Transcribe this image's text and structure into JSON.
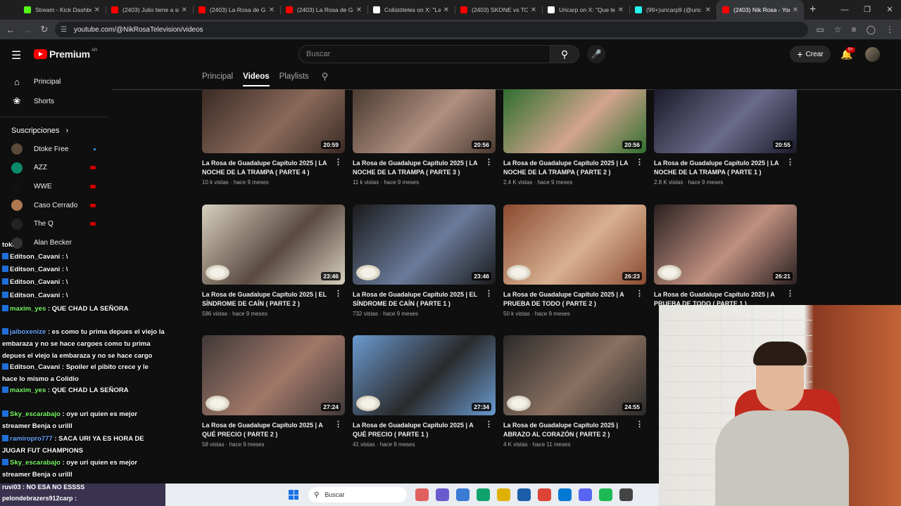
{
  "browser": {
    "tabs": [
      {
        "title": "Stream - Kick Dashbo",
        "favicon_color": "#53fc18",
        "active": false
      },
      {
        "title": "(2403) Julio tiene a su",
        "favicon_color": "#ff0000",
        "active": false
      },
      {
        "title": "(2403) La Rosa de Gu",
        "favicon_color": "#ff0000",
        "active": false
      },
      {
        "title": "(2403) La Rosa de Gu",
        "favicon_color": "#ff0000",
        "active": false
      },
      {
        "title": "Colistóteles on X: \"La",
        "favicon_color": "#ffffff",
        "active": false
      },
      {
        "title": "(2403) SKONE vs TOM",
        "favicon_color": "#ff0000",
        "active": false
      },
      {
        "title": "Uricarp on X: \"Que le",
        "favicon_color": "#ffffff",
        "active": false
      },
      {
        "title": "(99+)uricarp9 (@uric",
        "favicon_color": "#25f4ee",
        "active": false
      },
      {
        "title": "(2403) Nik Rosa - You",
        "favicon_color": "#ff0000",
        "active": true
      }
    ],
    "new_tab_icon": "+",
    "url": "youtube.com/@NikRosaTelevision/videos"
  },
  "youtube": {
    "logo_text": "Premium",
    "country_code": "AR",
    "search_placeholder": "Buscar",
    "create_label": "Crear",
    "notif_count": "9+"
  },
  "sidebar": {
    "items": [
      {
        "label": "Principal",
        "icon": "home-icon"
      },
      {
        "label": "Shorts",
        "icon": "shorts-icon"
      }
    ],
    "subs_header": "Suscripciones",
    "subscriptions": [
      {
        "name": "Dtoke Free",
        "avatar_color": "#5a4a3a",
        "indicator": "dot"
      },
      {
        "name": "AZZ",
        "avatar_color": "#0a8a6a",
        "indicator": "live"
      },
      {
        "name": "WWE",
        "avatar_color": "#111111",
        "indicator": "live"
      },
      {
        "name": "Caso Cerrado",
        "avatar_color": "#b07850",
        "indicator": "live"
      },
      {
        "name": "The Q",
        "avatar_color": "#222222",
        "indicator": "live"
      },
      {
        "name": "Alan Becker",
        "avatar_color": "#333333",
        "indicator": "none"
      }
    ]
  },
  "channel_tabs": [
    {
      "label": "Principal",
      "selected": false
    },
    {
      "label": "Videos",
      "selected": true
    },
    {
      "label": "Playlists",
      "selected": false
    }
  ],
  "videos": [
    {
      "title": "La Rosa de Guadalupe Capítulo 2025 | LA NOCHE DE LA TRAMPA ( PARTE 4 )",
      "views": "10 k vistas",
      "age": "hace 9 meses",
      "duration": "20:59"
    },
    {
      "title": "La Rosa de Guadalupe Capítulo 2025 | LA NOCHE DE LA TRAMPA ( PARTE 3 )",
      "views": "11 k vistas",
      "age": "hace 9 meses",
      "duration": "20:56"
    },
    {
      "title": "La Rosa de Guadalupe Capítulo 2025 | LA NOCHE DE LA TRAMPA ( PARTE 2 )",
      "views": "2.4 K vistas",
      "age": "hace 9 meses",
      "duration": "20:56"
    },
    {
      "title": "La Rosa de Guadalupe Capítulo 2025 | LA NOCHE DE LA TRAMPA ( PARTE 1 )",
      "views": "2.8 K vistas",
      "age": "hace 9 meses",
      "duration": "20:55"
    },
    {
      "title": "La Rosa de Guadalupe Capítulo 2025 | EL SÍNDROME DE CAÍN ( PARTE 2 )",
      "views": "586 vistas",
      "age": "hace 9 meses",
      "duration": "23:46"
    },
    {
      "title": "La Rosa de Guadalupe Capítulo 2025 | EL SÍNDROME DE CAÍN ( PARTE 1 )",
      "views": "732 vistas",
      "age": "hace 9 meses",
      "duration": "23:46"
    },
    {
      "title": "La Rosa de Guadalupe Capítulo 2025 | A PRUEBA DE TODO ( PARTE 2 )",
      "views": "50 k vistas",
      "age": "hace 9 meses",
      "duration": "26:23"
    },
    {
      "title": "La Rosa de Guadalupe Capítulo 2025 | A PRUEBA DE TODO ( PARTE 1 )",
      "views": "",
      "age": "",
      "duration": "26:21"
    },
    {
      "title": "La Rosa de Guadalupe Capítulo 2025 | A QUÉ PRECIO ( PARTE 2 )",
      "views": "58 vistas",
      "age": "hace 9 meses",
      "duration": "27:24"
    },
    {
      "title": "La Rosa de Guadalupe Capítulo 2025 | A QUÉ PRECIO ( PARTE 1 )",
      "views": "41 vistas",
      "age": "hace 9 meses",
      "duration": "27:34"
    },
    {
      "title": "La Rosa de Guadalupe Capítulo 2025 | ABRAZO AL CORAZÓN ( PARTE 2 )",
      "views": "4 K vistas",
      "age": "hace 11 meses",
      "duration": "24:55"
    }
  ],
  "chat": {
    "messages": [
      {
        "user": "tok.",
        "text": "",
        "user_color": "white"
      },
      {
        "user": "Editson_Cavani",
        "text": ": \\",
        "user_color": "white"
      },
      {
        "user": "Editson_Cavani",
        "text": ": \\",
        "user_color": "white"
      },
      {
        "user": "Editson_Cavani",
        "text": ": \\",
        "user_color": "white"
      },
      {
        "user": "Editson_Cavani",
        "text": ": \\",
        "user_color": "white"
      },
      {
        "user": "maxim_yes",
        "text": ": QUE CHAD LA SEÑORA",
        "user_color": "green"
      },
      {
        "user": "jaiboxenize",
        "text": ": es como tu prima depues el viejo la embaraza y no se hace cargoes como tu prima depues el viejo la embaraza y no se hace cargo",
        "user_color": "blue"
      },
      {
        "user": "Editson_Cavani",
        "text": ": Spoiler el pibito crece y le hace lo mismo a Colidio",
        "user_color": "white"
      },
      {
        "user": "maxim_yes",
        "text": ": QUE CHAD LA SEÑORA",
        "user_color": "green"
      },
      {
        "user": "Sky_escarabajo",
        "text": ": oye uri quien es mejor streamer Benja o urilll",
        "user_color": "green"
      },
      {
        "user": "ramiropro777",
        "text": ": SACA URI YA ES HORA DE JUGAR FUT CHAMPIONS",
        "user_color": "blue"
      },
      {
        "user": "Sky_escarabajo",
        "text": ": oye uri quien es mejor streamer Benja o urilll",
        "user_color": "green"
      }
    ],
    "bottom_line1": "ruvi03 : NO ESA NO ESSSS",
    "bottom_line2": "pelondebrazers912carp :"
  },
  "taskbar": {
    "search_label": "Buscar",
    "app_icons": [
      "#e06060",
      "#6a5acd",
      "#3a7bd5",
      "#0fa36b",
      "#e0b000",
      "#1b5eaa",
      "#db4437",
      "#0078d4",
      "#5865f2",
      "#1db954",
      "#444444"
    ]
  }
}
